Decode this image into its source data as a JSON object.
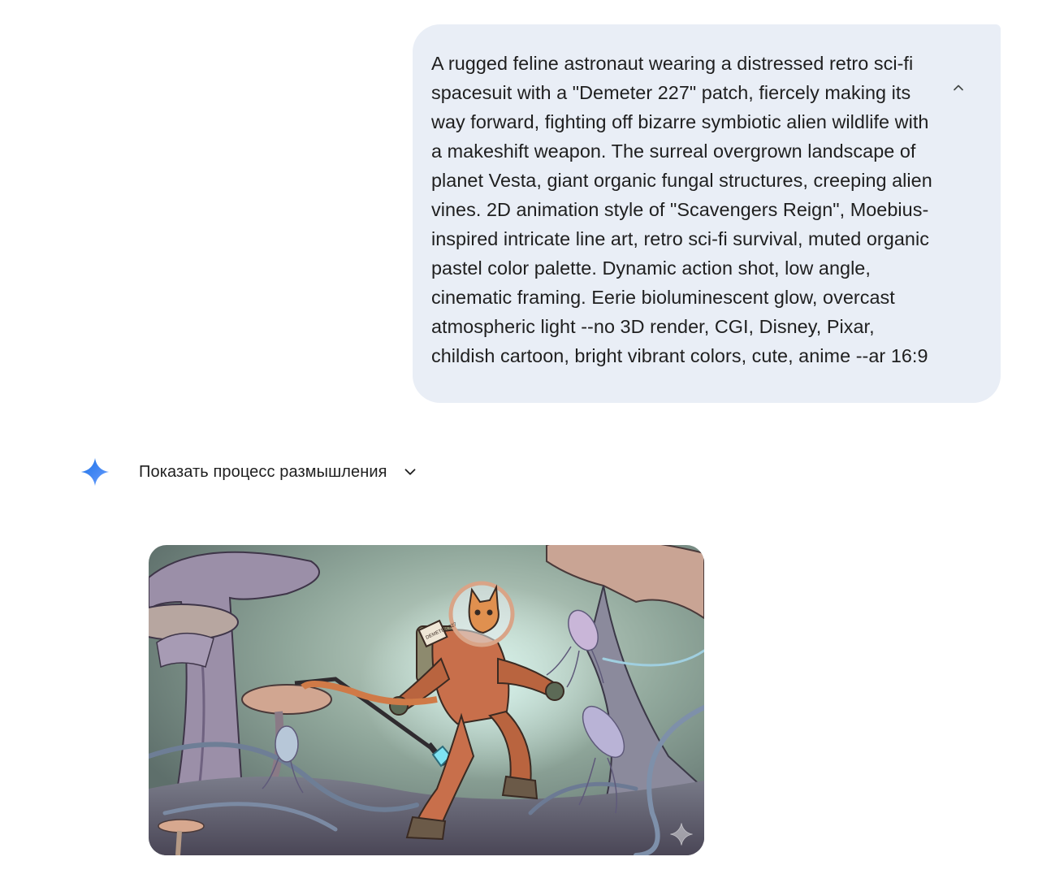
{
  "user_prompt": {
    "text": "A rugged feline astronaut wearing a distressed retro sci-fi spacesuit with a \"Demeter 227\" patch, fiercely making its way forward, fighting off bizarre symbiotic alien wildlife with a makeshift weapon. The surreal overgrown landscape of planet Vesta, giant organic fungal structures, creeping alien vines. 2D animation style of \"Scavengers Reign\", Moebius-inspired intricate line art, retro sci-fi survival, muted organic pastel color palette. Dynamic action shot, low angle, cinematic framing. Eerie bioluminescent glow, overcast atmospheric light --no 3D render, CGI, Disney, Pixar, childish cartoon, bright vibrant colors, cute, anime --ar 16:9",
    "collapse_icon": "chevron-up-icon"
  },
  "response": {
    "avatar_icon": "gemini-sparkle-icon",
    "thinking_toggle_label": "Показать процесс размышления",
    "thinking_toggle_icon": "chevron-down-icon",
    "generated_image": {
      "subject": "generated illustration",
      "patch_text": "DEMETER 227",
      "watermark_icon": "sparkle-watermark-icon"
    }
  },
  "colors": {
    "user_bubble_bg": "#e9eef6",
    "text": "#1f1f1f",
    "gemini_blue": "#4285f4"
  }
}
